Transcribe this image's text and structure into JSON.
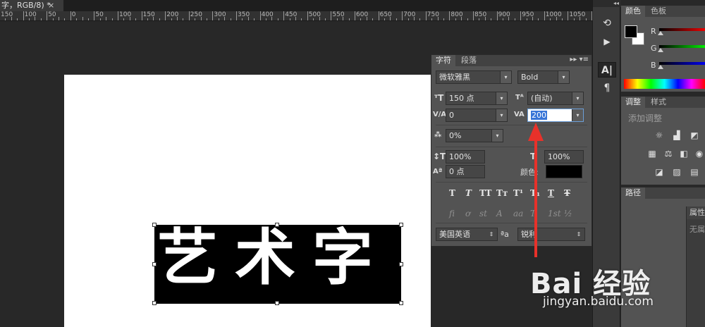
{
  "document": {
    "tab_title": "字，RGB/8) *",
    "close_glyph": "×"
  },
  "ruler": {
    "labels": [
      "150",
      "100",
      "50",
      "0",
      "50",
      "100",
      "150",
      "200",
      "250",
      "300",
      "350",
      "400",
      "450",
      "500",
      "550",
      "600",
      "650",
      "700",
      "750",
      "800",
      "850",
      "900",
      "950",
      "1000",
      "1050",
      "110"
    ]
  },
  "canvas": {
    "art_text": "艺术字"
  },
  "character_panel": {
    "tabs": [
      {
        "label": "字符",
        "active": true
      },
      {
        "label": "段落",
        "active": false
      }
    ],
    "menu_glyph": "▸▸ ▾≡",
    "font_family": "微软雅黑",
    "font_style": "Bold",
    "font_size": "150 点",
    "leading": "(自动)",
    "kerning": "0",
    "tracking": "200",
    "tsume": "0%",
    "vertical_scale": "100%",
    "horizontal_scale": "100%",
    "baseline_shift": "0 点",
    "color_label": "颜色:",
    "style_buttons": [
      "T",
      "T",
      "TT",
      "Tт",
      "T¹",
      "T₁",
      "T",
      "Ŧ"
    ],
    "opentype_buttons": [
      "fi",
      "ơ",
      "st",
      "A",
      "aa",
      "T",
      "1st",
      "½"
    ],
    "language": "美国英语",
    "aa_label": "ªa",
    "antialias": "锐利",
    "icons": {
      "size": "font-size-icon",
      "leading": "leading-icon",
      "kerning": "kerning-icon",
      "tracking": "tracking-icon",
      "tsume": "tsume-icon",
      "vscale": "vertical-scale-icon",
      "hscale": "horizontal-scale-icon",
      "baseline": "baseline-shift-icon"
    }
  },
  "toolstrip": {
    "collapse_glyph": "◂◂",
    "buttons": [
      {
        "name": "history-icon",
        "glyph": "⟲"
      },
      {
        "name": "play-icon",
        "glyph": "▶"
      },
      {
        "name": "character-panel-icon",
        "glyph": "A|"
      },
      {
        "name": "paragraph-panel-icon",
        "glyph": "¶"
      }
    ]
  },
  "color_panel": {
    "tabs": [
      {
        "label": "颜色",
        "active": true
      },
      {
        "label": "色板",
        "active": false
      }
    ],
    "channels": [
      "R",
      "G",
      "B"
    ]
  },
  "adjustments_panel": {
    "tabs": [
      {
        "label": "调整",
        "active": true
      },
      {
        "label": "样式",
        "active": false
      }
    ],
    "add_label": "添加调整"
  },
  "paths_panel": {
    "tab": "路径"
  },
  "properties_panel": {
    "tab": "属性",
    "content": "无属"
  },
  "watermark": {
    "logo": "Bai 经验",
    "url": "jingyan.baidu.com"
  },
  "colors": {
    "panel_bg": "#535353",
    "selection_blue": "#3875d7",
    "arrow_red": "#e8312a"
  }
}
